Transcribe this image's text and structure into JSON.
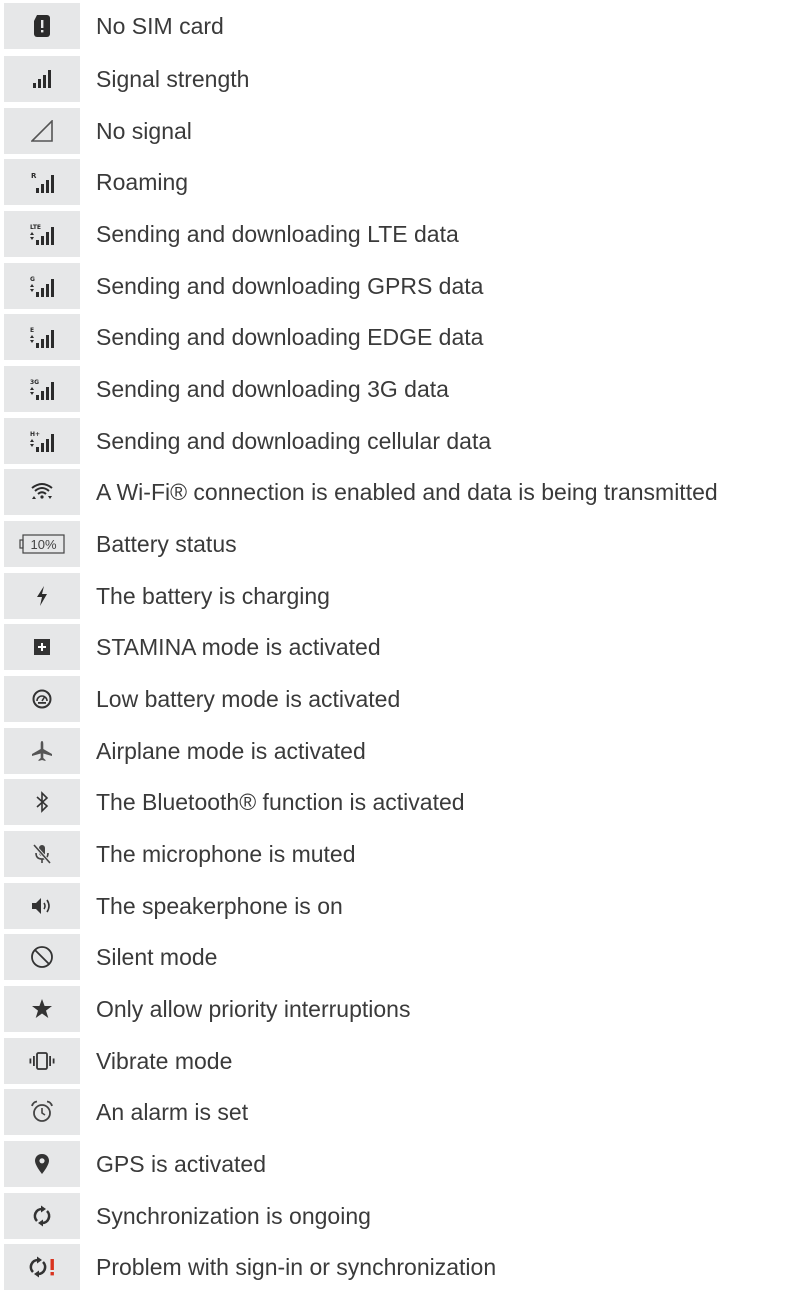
{
  "items": [
    {
      "icon": "no-sim-card-icon",
      "label": "No SIM card"
    },
    {
      "icon": "signal-strength-icon",
      "label": "Signal strength"
    },
    {
      "icon": "no-signal-icon",
      "label": "No signal"
    },
    {
      "icon": "roaming-icon",
      "label": "Roaming",
      "badge": "R"
    },
    {
      "icon": "lte-data-icon",
      "label": "Sending and downloading LTE data",
      "badge": "LTE"
    },
    {
      "icon": "gprs-data-icon",
      "label": "Sending and downloading GPRS data",
      "badge": "G"
    },
    {
      "icon": "edge-data-icon",
      "label": "Sending and downloading EDGE data",
      "badge": "E"
    },
    {
      "icon": "3g-data-icon",
      "label": "Sending and downloading 3G data",
      "badge": "3G"
    },
    {
      "icon": "cellular-data-icon",
      "label": "Sending and downloading cellular data",
      "badge": "H+"
    },
    {
      "icon": "wifi-icon",
      "label": "A Wi-Fi® connection is enabled and data is being transmitted"
    },
    {
      "icon": "battery-status-icon",
      "label": "Battery status",
      "badge": "10%"
    },
    {
      "icon": "charging-icon",
      "label": "The battery is charging"
    },
    {
      "icon": "stamina-mode-icon",
      "label": "STAMINA mode is activated"
    },
    {
      "icon": "low-battery-mode-icon",
      "label": "Low battery mode is activated"
    },
    {
      "icon": "airplane-icon",
      "label": "Airplane mode is activated"
    },
    {
      "icon": "bluetooth-icon",
      "label": "The Bluetooth® function is activated"
    },
    {
      "icon": "mic-muted-icon",
      "label": "The microphone is muted"
    },
    {
      "icon": "speakerphone-icon",
      "label": "The speakerphone is on"
    },
    {
      "icon": "silent-mode-icon",
      "label": "Silent mode"
    },
    {
      "icon": "star-icon",
      "label": "Only allow priority interruptions"
    },
    {
      "icon": "vibrate-icon",
      "label": "Vibrate mode"
    },
    {
      "icon": "alarm-icon",
      "label": "An alarm is set"
    },
    {
      "icon": "gps-icon",
      "label": "GPS is activated"
    },
    {
      "icon": "sync-icon",
      "label": "Synchronization is ongoing"
    },
    {
      "icon": "sync-problem-icon",
      "label": "Problem with sign-in or synchronization"
    }
  ]
}
